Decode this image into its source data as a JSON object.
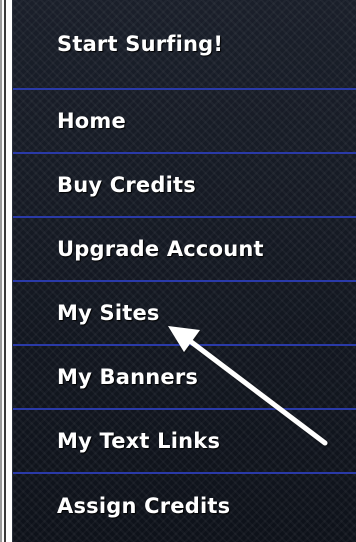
{
  "menu": {
    "items": [
      {
        "label": "Start Surfing!"
      },
      {
        "label": "Home"
      },
      {
        "label": "Buy Credits"
      },
      {
        "label": "Upgrade Account"
      },
      {
        "label": "My Sites"
      },
      {
        "label": "My Banners"
      },
      {
        "label": "My Text Links"
      },
      {
        "label": "Assign Credits"
      }
    ]
  },
  "annotation": {
    "arrow_target": "My Sites",
    "arrow_color": "#ffffff"
  },
  "colors": {
    "panel_background": "#12161f",
    "divider": "#2a3aa8",
    "text": "#ffffff"
  }
}
